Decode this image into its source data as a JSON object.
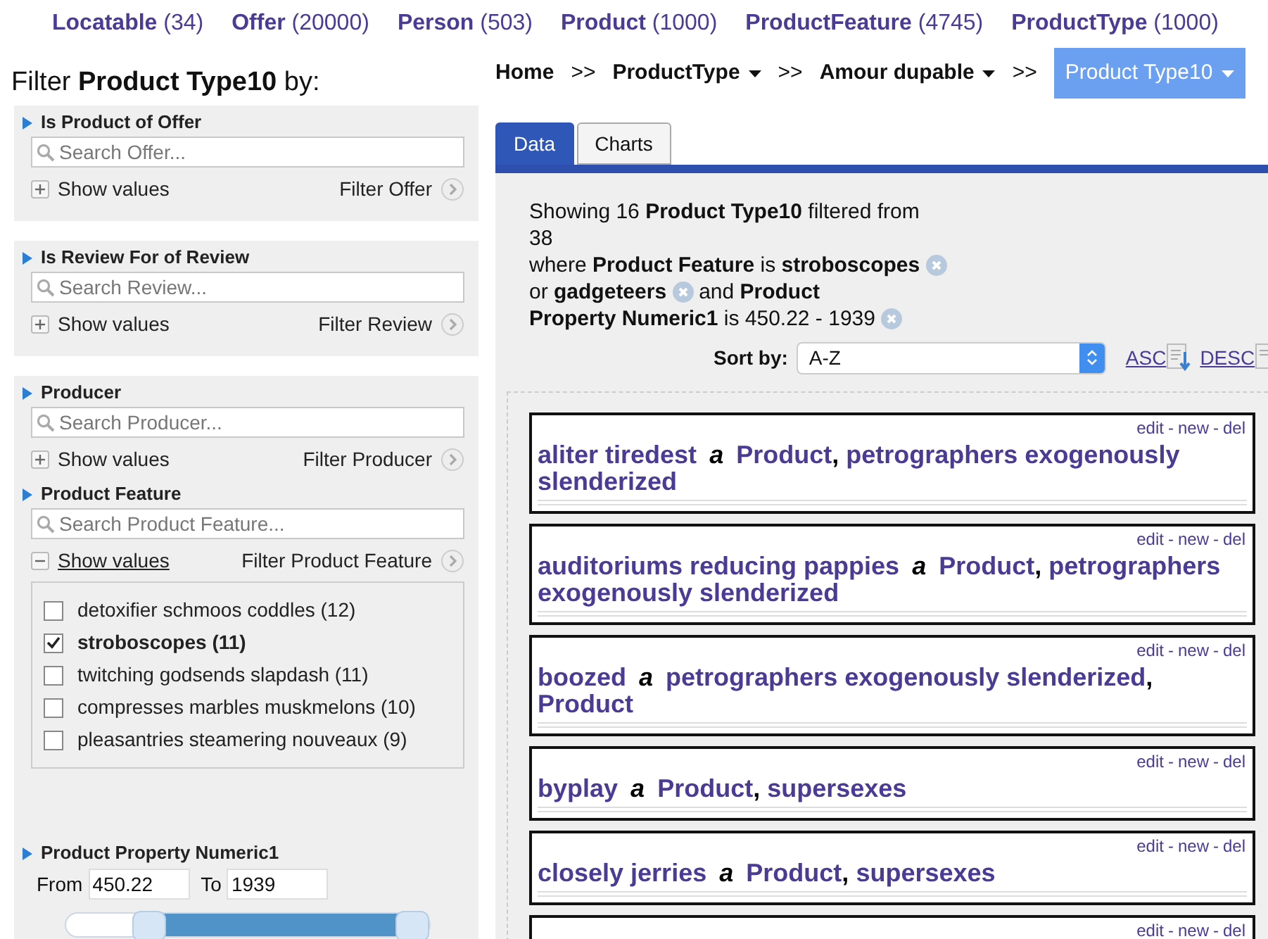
{
  "top_nav": [
    {
      "label": "Locatable",
      "count": "(34)"
    },
    {
      "label": "Offer",
      "count": "(20000)"
    },
    {
      "label": "Person",
      "count": "(503)"
    },
    {
      "label": "Product",
      "count": "(1000)"
    },
    {
      "label": "ProductFeature",
      "count": "(4745)"
    },
    {
      "label": "ProductType",
      "count": "(1000)"
    }
  ],
  "filter_title": "Filter **Product Type10** by:",
  "filter_groups": [
    {
      "sections": [
        {
          "kind": "search",
          "title": "Is Product of Offer",
          "placeholder": "Search Offer...",
          "show_values": "Show values",
          "expanded": false,
          "filter": "Filter Offer"
        }
      ]
    },
    {
      "sections": [
        {
          "kind": "search",
          "title": "Is Review For of Review",
          "placeholder": "Search Review...",
          "show_values": "Show values",
          "expanded": false,
          "filter": "Filter Review"
        }
      ]
    },
    {
      "sections": [
        {
          "kind": "search",
          "title": "Producer",
          "placeholder": "Search Producer...",
          "show_values": "Show values",
          "expanded": false,
          "filter": "Filter Producer"
        },
        {
          "kind": "search",
          "title": "Product Feature",
          "placeholder": "Search Product Feature...",
          "show_values": "Show values",
          "expanded": true,
          "filter": "Filter Product Feature",
          "values": [
            {
              "label": "detoxifier schmoos coddles (12)",
              "checked": false
            },
            {
              "label": "stroboscopes (11)",
              "checked": true
            },
            {
              "label": "twitching godsends slapdash (11)",
              "checked": false
            },
            {
              "label": "compresses marbles muskmelons (10)",
              "checked": false
            },
            {
              "label": "pleasantries steamering nouveaux (9)",
              "checked": false
            }
          ]
        },
        {
          "kind": "range",
          "title": "Product Property Numeric1",
          "from_label": "From",
          "from": "450.22",
          "to_label": "To",
          "to": "1939",
          "thumbs": [
            {
              "level": 0.2
            },
            {
              "level": 1
            }
          ]
        }
      ]
    }
  ],
  "breadcrumb": [
    {
      "label": "Home",
      "sep": ">>",
      "dropdown": false,
      "selected": false
    },
    {
      "label": "ProductType",
      "sep": ">>",
      "dropdown": true,
      "selected": false
    },
    {
      "label": "Amour dupable",
      "sep": ">>",
      "dropdown": true,
      "selected": false
    },
    {
      "label": "Product Type10",
      "dropdown": true,
      "selected": true
    }
  ],
  "tabs": [
    {
      "label": "Data",
      "selected": true
    },
    {
      "label": "Charts",
      "selected": false
    }
  ],
  "summary": {
    "heading": "Showing 16 **Product Type10** filtered from 38",
    "conditions": [
      {
        "kind": "text",
        "text": "where **Product Feature** is **stroboscopes**"
      },
      {
        "kind": "remove"
      },
      {
        "kind": "text",
        "text": "or **gadgeteers**"
      },
      {
        "kind": "remove"
      },
      {
        "kind": "text",
        "text": "and **Product**"
      },
      {
        "kind": "text",
        "text": "**Property Numeric1** is 450.22 - 1939"
      },
      {
        "kind": "remove"
      }
    ]
  },
  "sort": {
    "label": "Sort by:",
    "value": "A-Z",
    "asc": "ASC",
    "desc": "DESC"
  },
  "results": [
    {
      "actions": [
        "edit",
        "new",
        "del"
      ],
      "action_separator": "-",
      "name": "aliter tiredest",
      "article": "a",
      "types": [
        "Product",
        "petrographers exogenously slenderized"
      ],
      "type_separator": ","
    },
    {
      "actions": [
        "edit",
        "new",
        "del"
      ],
      "action_separator": "-",
      "name": "auditoriums reducing pappies",
      "article": "a",
      "types": [
        "Product",
        "petrographers exogenously slenderized"
      ],
      "type_separator": ","
    },
    {
      "actions": [
        "edit",
        "new",
        "del"
      ],
      "action_separator": "-",
      "name": "boozed",
      "article": "a",
      "types": [
        "petrographers exogenously slenderized",
        "Product"
      ],
      "type_separator": ","
    },
    {
      "actions": [
        "edit",
        "new",
        "del"
      ],
      "action_separator": "-",
      "name": "byplay",
      "article": "a",
      "types": [
        "Product",
        "supersexes"
      ],
      "type_separator": ","
    },
    {
      "actions": [
        "edit",
        "new",
        "del"
      ],
      "action_separator": "-",
      "name": "closely jerries",
      "article": "a",
      "types": [
        "Product",
        "supersexes"
      ],
      "type_separator": ","
    },
    {
      "actions": [
        "edit",
        "new",
        "del"
      ],
      "action_separator": "-"
    }
  ]
}
